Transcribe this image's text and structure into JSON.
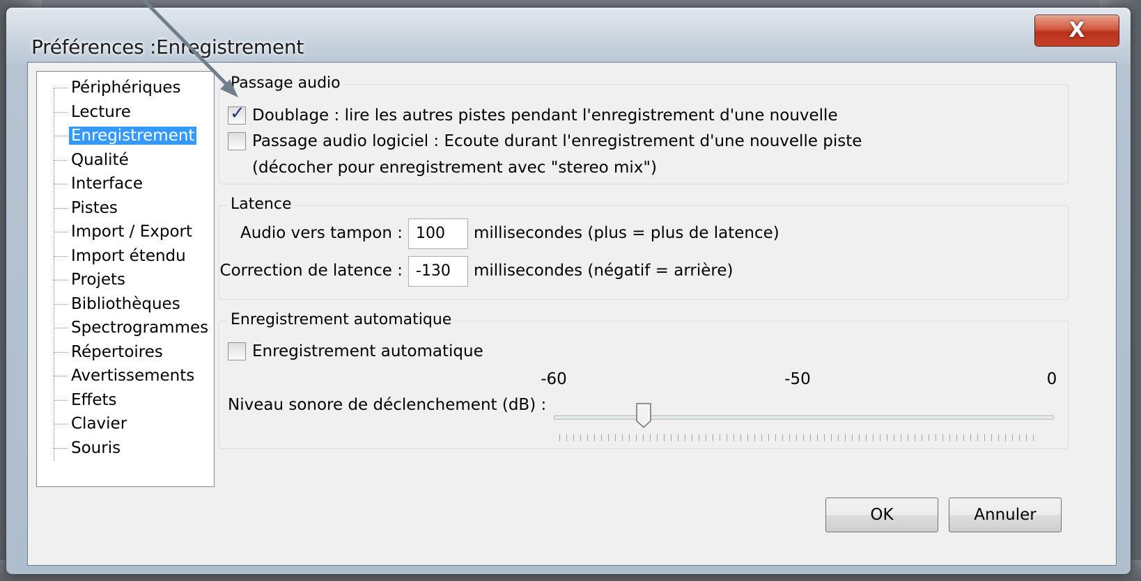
{
  "window": {
    "title": "Préférences :Enregistrement",
    "close_label": "X"
  },
  "tree": {
    "items": [
      {
        "label": "Périphériques"
      },
      {
        "label": "Lecture"
      },
      {
        "label": "Enregistrement",
        "selected": true
      },
      {
        "label": "Qualité"
      },
      {
        "label": "Interface"
      },
      {
        "label": "Pistes"
      },
      {
        "label": "Import / Export"
      },
      {
        "label": "Import étendu"
      },
      {
        "label": "Projets"
      },
      {
        "label": "Bibliothèques"
      },
      {
        "label": "Spectrogrammes"
      },
      {
        "label": "Répertoires"
      },
      {
        "label": "Avertissements"
      },
      {
        "label": "Effets"
      },
      {
        "label": "Clavier"
      },
      {
        "label": "Souris"
      }
    ]
  },
  "passage_audio": {
    "title": "Passage audio",
    "overdub": {
      "label": "Doublage : lire les autres pistes pendant l'enregistrement d'une nouvelle",
      "checked": true
    },
    "software_playthrough": {
      "label": "Passage audio logiciel : Ecoute durant l'enregistrement d'une nouvelle piste",
      "checked": false
    },
    "software_note": "(décocher pour enregistrement avec \"stereo mix\")"
  },
  "latence": {
    "title": "Latence",
    "buffer_label": "Audio vers tampon :",
    "buffer_value": "100",
    "buffer_unit": "millisecondes (plus = plus de latence)",
    "correction_label": "Correction de latence :",
    "correction_value": "-130",
    "correction_unit": "millisecondes (négatif = arrière)"
  },
  "auto_record": {
    "title": "Enregistrement automatique",
    "checkbox_label": "Enregistrement automatique",
    "checked": false,
    "threshold_label": "Niveau sonore de déclenchement (dB) :",
    "scale_labels": [
      "-60",
      "-50",
      "0"
    ],
    "threshold_fraction": 0.18
  },
  "buttons": {
    "ok": "OK",
    "cancel": "Annuler"
  },
  "colors": {
    "selection": "#3399ff",
    "close_button": "#c8412a",
    "arrow": "#6f7f8c"
  }
}
